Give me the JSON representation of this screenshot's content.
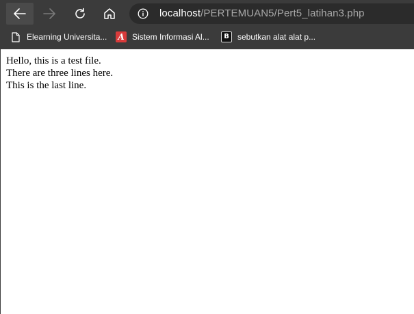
{
  "browser": {
    "address_bar": {
      "host": "localhost",
      "path": "/PERTEMUAN5/Pert5_latihan3.php"
    },
    "bookmarks": [
      {
        "label": "Elearning Universita...",
        "icon": "page-icon"
      },
      {
        "label": "Sistem Informasi Al...",
        "icon": "red-a-icon"
      },
      {
        "label": "sebutkan alat alat p...",
        "icon": "black-b-icon"
      }
    ],
    "bookmark_icon_letters": {
      "a": "A",
      "b": "B"
    },
    "toolbar_color": "#3b3b3b",
    "address_bar_color": "#2b2b2b"
  },
  "page": {
    "lines": [
      "Hello, this is a test file.",
      "There are three lines here.",
      "This is the last line."
    ]
  }
}
